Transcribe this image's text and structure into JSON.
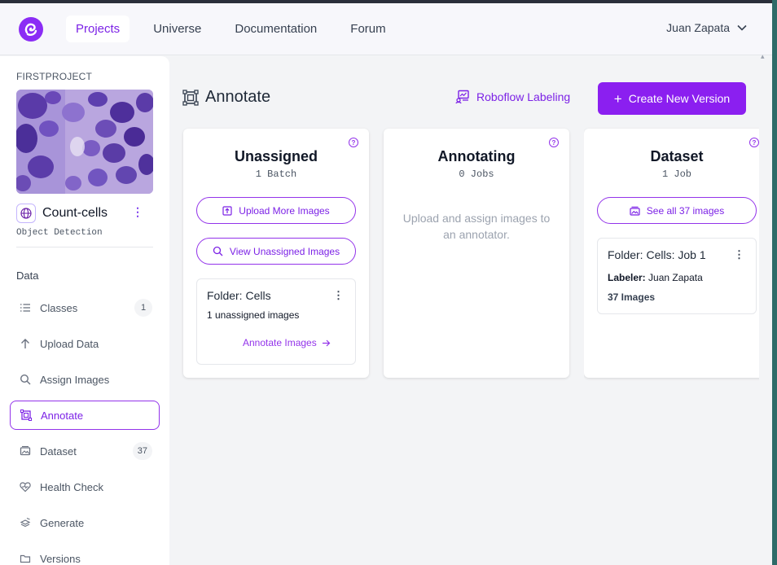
{
  "header": {
    "nav": [
      {
        "label": "Projects",
        "active": true
      },
      {
        "label": "Universe",
        "active": false
      },
      {
        "label": "Documentation",
        "active": false
      },
      {
        "label": "Forum",
        "active": false
      }
    ],
    "user_name": "Juan Zapata"
  },
  "sidebar": {
    "workspace_label": "FIRSTPROJECT",
    "project_name": "Count-cells",
    "project_type": "Object Detection",
    "section_label": "Data",
    "items": [
      {
        "label": "Classes",
        "icon": "list-icon",
        "badge": "1"
      },
      {
        "label": "Upload Data",
        "icon": "arrow-up-icon",
        "badge": ""
      },
      {
        "label": "Assign Images",
        "icon": "search-icon",
        "badge": ""
      },
      {
        "label": "Annotate",
        "icon": "annotate-icon",
        "badge": "",
        "active": true
      },
      {
        "label": "Dataset",
        "icon": "images-icon",
        "badge": "37"
      },
      {
        "label": "Health Check",
        "icon": "heart-pulse-icon",
        "badge": ""
      },
      {
        "label": "Generate",
        "icon": "layers-icon",
        "badge": ""
      },
      {
        "label": "Versions",
        "icon": "folder-icon",
        "badge": ""
      }
    ]
  },
  "main": {
    "title": "Annotate",
    "roboflow_labeling": "Roboflow Labeling",
    "create_version": "Create New Version",
    "columns": {
      "unassigned": {
        "title": "Unassigned",
        "subtitle": "1 Batch",
        "upload_more": "Upload More Images",
        "view_unassigned": "View Unassigned Images",
        "batch": {
          "title": "Folder: Cells",
          "detail": "1 unassigned images",
          "action": "Annotate Images"
        }
      },
      "annotating": {
        "title": "Annotating",
        "subtitle": "0 Jobs",
        "empty_text": "Upload and assign images to an annotator."
      },
      "dataset": {
        "title": "Dataset",
        "subtitle": "1 Job",
        "see_all": "See all 37 images",
        "job": {
          "title": "Folder: Cells: Job 1",
          "labeler_label": "Labeler:",
          "labeler_name": "Juan Zapata",
          "count": "37 Images"
        }
      }
    }
  },
  "colors": {
    "accent": "#8b1ff0",
    "accent_text": "#7c22e6"
  }
}
